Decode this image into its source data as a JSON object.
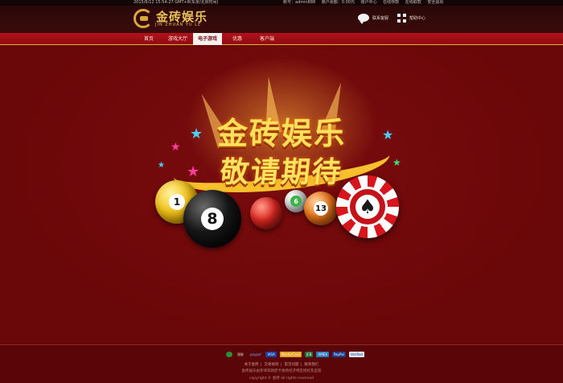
{
  "topbar": {
    "datetime": "2015/6/12  15:54:27  GMT+8(东京/北京时间)",
    "account": "账号：admin888",
    "balance": "账户余额：0.00元",
    "links": [
      "账户中心",
      "在线存款",
      "在线取款",
      "安全退出"
    ]
  },
  "header": {
    "logo_title": "金砖娱乐",
    "logo_sub": "JIN ZHUAN YU LE",
    "contact_label": "联系客服",
    "help_label": "帮助中心"
  },
  "nav": {
    "items": [
      "首页",
      "游戏大厅",
      "电子游戏",
      "优惠",
      "客户端"
    ],
    "active": "电子游戏"
  },
  "banner": {
    "line1": "金砖娱乐",
    "line2": "敬请期待",
    "balls": [
      "1",
      "8",
      "6",
      "13"
    ],
    "chip_icon": "spade-icon"
  },
  "footer": {
    "payments": [
      "银联",
      "paypal",
      "VISA",
      "MasterCard",
      "JCB",
      "AMEX",
      "PayPal",
      "Verified"
    ],
    "links": [
      "关于金砖",
      "交易规则",
      "常见问题",
      "联系我们"
    ],
    "note": "金砖娱乐由菲律宾政府卡格扬经济特区授权及监管",
    "copyright": "copyright © 金砖 all rights reserved"
  },
  "colors": {
    "background": "#6b0708",
    "nav": "#b4121a",
    "gold": "#ffd23a"
  }
}
